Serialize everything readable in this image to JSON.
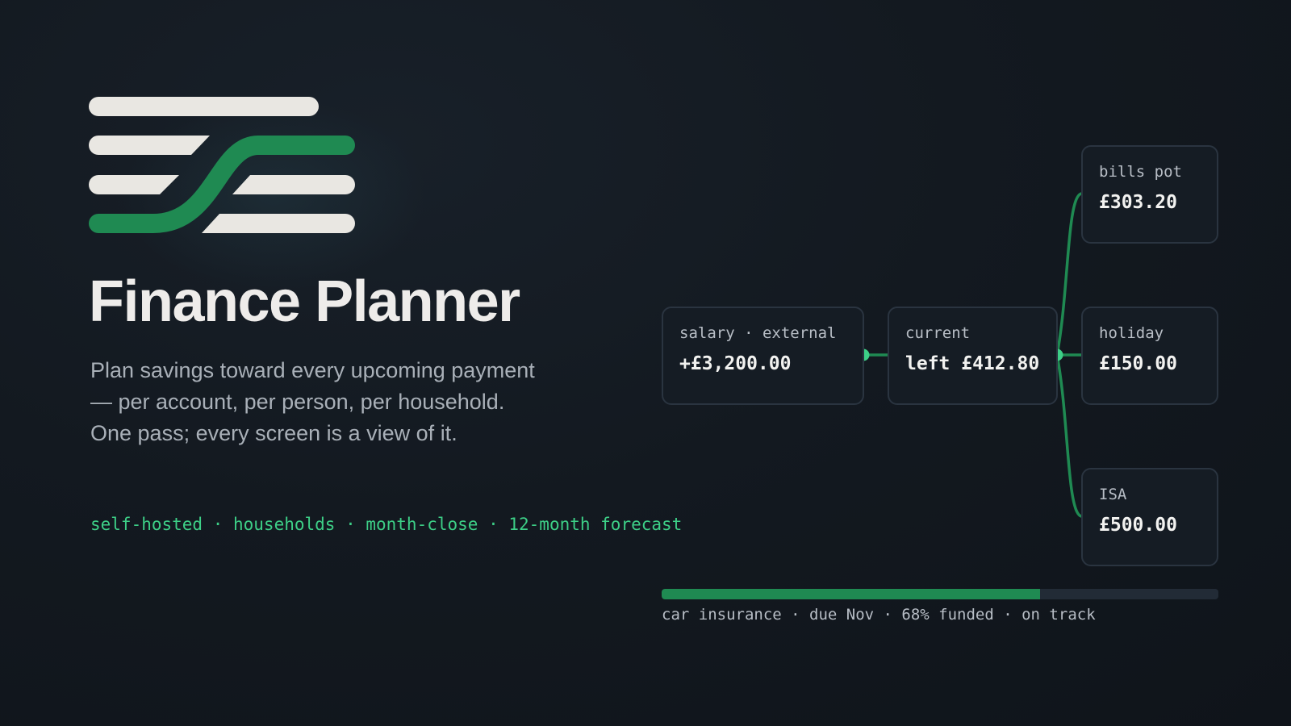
{
  "app": {
    "title": "Finance Planner",
    "description": "Plan savings toward every upcoming payment — per account, per person, per household. One pass; every screen is a view of it.",
    "features": "self-hosted · households · month-close · 12-month forecast"
  },
  "colors": {
    "background": "#131920",
    "accent": "#3dcf87",
    "accent_dark": "#1f8a52",
    "text_primary": "#eeecea",
    "text_muted": "#a9b0b8",
    "node_background": "#151c24",
    "node_border": "#2a3440"
  },
  "flow": {
    "source": {
      "label": "salary · external",
      "value": "+£3,200.00"
    },
    "account": {
      "label": "current",
      "value": "left £412.80"
    },
    "pots": [
      {
        "label": "bills pot",
        "value": "£303.20"
      },
      {
        "label": "holiday",
        "value": "£150.00"
      },
      {
        "label": "ISA",
        "value": "£500.00"
      }
    ]
  },
  "goal": {
    "caption": "car insurance · due Nov · 68% funded · on track",
    "funded_fraction": 0.68
  }
}
